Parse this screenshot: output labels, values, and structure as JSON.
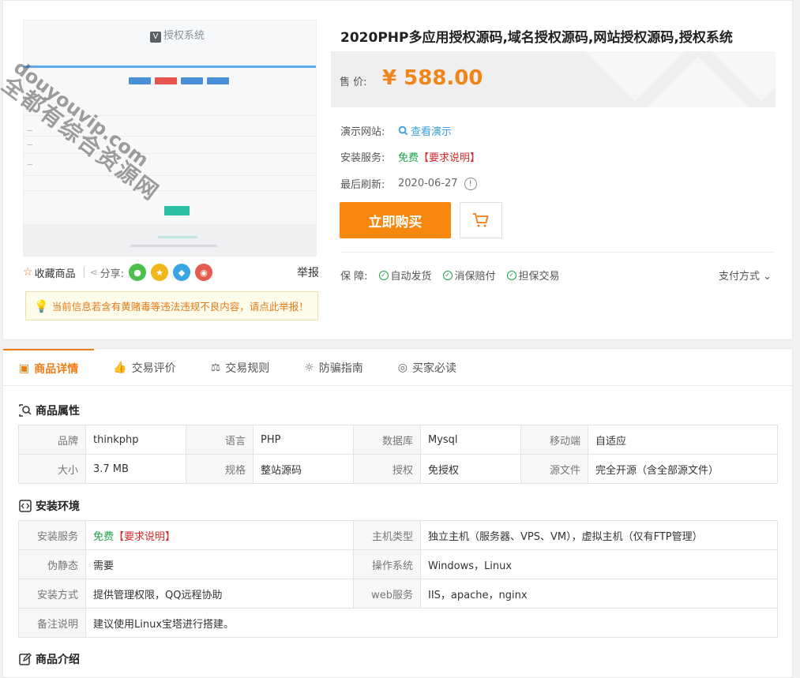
{
  "preview": {
    "logo_text": "授权系统",
    "watermark_cn": "全都有综合资源网",
    "watermark_en": "douyouvip.com"
  },
  "actions": {
    "favorite": "收藏商品",
    "share": "分享:",
    "report": "举报"
  },
  "notice": "当前信息若含有黄赌毒等违法违规不良内容，请点此举报！",
  "product": {
    "title": "2020PHP多应用授权源码,域名授权源码,网站授权源码,授权系统",
    "price_label": "售 价:",
    "price": "¥ 588.00",
    "demo_label": "演示网站:",
    "demo_link": "查看演示",
    "install_label": "安装服务:",
    "install_free": "免费",
    "install_req": "【要求说明】",
    "refresh_label": "最后刷新:",
    "refresh_date": "2020-06-27",
    "buy_button": "立即购买",
    "guarantee_label": "保 障:",
    "guarantees": [
      "自动发货",
      "消保赔付",
      "担保交易"
    ],
    "payment": "支付方式"
  },
  "tabs": [
    "商品详情",
    "交易评价",
    "交易规则",
    "防骗指南",
    "买家必读"
  ],
  "attributes": {
    "title": "商品属性",
    "rows": [
      [
        [
          "品牌",
          "thinkphp"
        ],
        [
          "语言",
          "PHP"
        ],
        [
          "数据库",
          "Mysql"
        ],
        [
          "移动端",
          "自适应"
        ]
      ],
      [
        [
          "大小",
          "3.7 MB"
        ],
        [
          "规格",
          "整站源码"
        ],
        [
          "授权",
          "免授权"
        ],
        [
          "源文件",
          "完全开源（含全部源文件）"
        ]
      ]
    ]
  },
  "environment": {
    "title": "安装环境",
    "install_key": "安装服务",
    "install_free": "免费",
    "install_req": "【要求说明】",
    "host_key": "主机类型",
    "host_val": "独立主机（服务器、VPS、VM），虚拟主机（仅有FTP管理）",
    "pseudo_key": "伪静态",
    "pseudo_val": "需要",
    "os_key": "操作系统",
    "os_val": "Windows，Linux",
    "method_key": "安装方式",
    "method_val": "提供管理权限，QQ远程协助",
    "web_key": "web服务",
    "web_val": "IIS，apache，nginx",
    "note_key": "备注说明",
    "note_val": "建议使用Linux宝塔进行搭建。"
  },
  "intro": {
    "title": "商品介绍"
  },
  "colors": {
    "accent": "#f7880f",
    "price": "#f08519",
    "link": "#3a9fdb",
    "free": "#1ea445",
    "required": "#d42b2b"
  }
}
